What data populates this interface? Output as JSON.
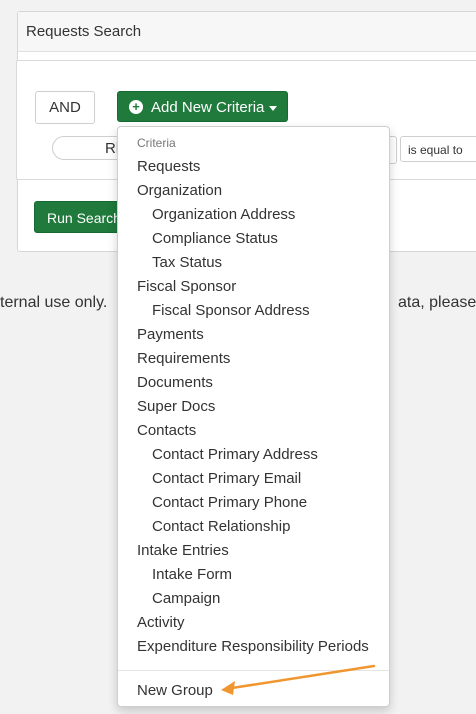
{
  "panel": {
    "title": "Requests Search"
  },
  "criteria": {
    "and_label": "AND",
    "add_label": "Add New Criteria",
    "pill_text": "Rl",
    "operator": "is equal to"
  },
  "run_label": "Run Search",
  "notes": {
    "left": "ternal use only.",
    "right": "ata, please c"
  },
  "menu": {
    "header": "Criteria",
    "items": [
      {
        "label": "Requests",
        "level": 0
      },
      {
        "label": "Organization",
        "level": 0
      },
      {
        "label": "Organization Address",
        "level": 1
      },
      {
        "label": "Compliance Status",
        "level": 1
      },
      {
        "label": "Tax Status",
        "level": 1
      },
      {
        "label": "Fiscal Sponsor",
        "level": 0
      },
      {
        "label": "Fiscal Sponsor Address",
        "level": 1
      },
      {
        "label": "Payments",
        "level": 0
      },
      {
        "label": "Requirements",
        "level": 0
      },
      {
        "label": "Documents",
        "level": 0
      },
      {
        "label": "Super Docs",
        "level": 0
      },
      {
        "label": "Contacts",
        "level": 0
      },
      {
        "label": "Contact Primary Address",
        "level": 1
      },
      {
        "label": "Contact Primary Email",
        "level": 1
      },
      {
        "label": "Contact Primary Phone",
        "level": 1
      },
      {
        "label": "Contact Relationship",
        "level": 1
      },
      {
        "label": "Intake Entries",
        "level": 0
      },
      {
        "label": "Intake Form",
        "level": 1
      },
      {
        "label": "Campaign",
        "level": 1
      },
      {
        "label": "Activity",
        "level": 0
      },
      {
        "label": "Expenditure Responsibility Periods",
        "level": 0
      }
    ],
    "new_group": "New Group"
  },
  "colors": {
    "primary_green": "#1f7a3c",
    "annotation_arrow": "#f0962f"
  }
}
